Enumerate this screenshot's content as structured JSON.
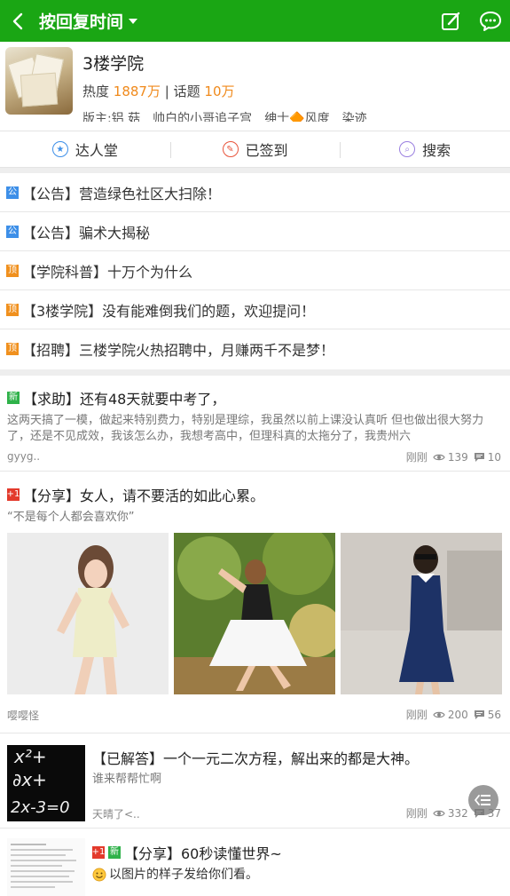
{
  "header": {
    "title": "按回复时间",
    "back_icon": "chevron-left-icon",
    "compose_icon": "compose-icon",
    "chat_icon": "chat-bubble-icon",
    "bar_color": "#1aa614"
  },
  "forum": {
    "name": "3楼学院",
    "heat_label": "热度",
    "heat_value": "1887万",
    "sep": "|",
    "topics_label": "话题",
    "topics_value": "10万",
    "moderators": "版主:铝 菇　帅白的小哥追子宫　绅士🔶风度　染迹"
  },
  "actions": [
    {
      "label": "达人堂",
      "icon": "star-badge-icon",
      "color": "#3d8fe8"
    },
    {
      "label": "已签到",
      "icon": "checkin-icon",
      "color": "#e8553c"
    },
    {
      "label": "搜索",
      "icon": "search-icon",
      "color": "#9a7fe0"
    }
  ],
  "notices": [
    {
      "tag": "公",
      "tag_color": "blue",
      "title": "【公告】营造绿色社区大扫除！"
    },
    {
      "tag": "公",
      "tag_color": "blue",
      "title": "【公告】骗术大揭秘"
    },
    {
      "tag": "顶",
      "tag_color": "orange",
      "title": "【学院科普】十万个为什么"
    },
    {
      "tag": "顶",
      "tag_color": "orange",
      "title": "【3楼学院】没有能难倒我们的题，欢迎提问！"
    },
    {
      "tag": "顶",
      "tag_color": "orange",
      "title": "【招聘】三楼学院火热招聘中，月赚两千不是梦！"
    }
  ],
  "posts": [
    {
      "tag": "新",
      "title": "【求助】还有48天就要中考了，",
      "excerpt": "这两天搞了一模，做起来特别费力，特别是理综，我虽然以前上课没认真听 但也做出很大努力了，还是不见成效，我该怎么办，我想考高中，但理科真的太拖分了，我贵州六",
      "author": "gyyg..",
      "time": "刚刚",
      "views": "139",
      "comments": "10"
    },
    {
      "tag": "+1",
      "title": "【分享】女人，请不要活的如此心累。",
      "subtitle": "“不是每个人都会喜欢你”",
      "author": "嘤嘤怪",
      "time": "刚刚",
      "views": "200",
      "comments": "56"
    },
    {
      "title": "【已解答】一个一元二次方程，解出来的都是大神。",
      "excerpt": "谁来帮帮忙啊",
      "author": "天晴了<..",
      "time": "刚刚",
      "views": "332",
      "comments": "37",
      "thumb_text": "x²+\n∂x+\n2x-3=0"
    },
    {
      "tags": [
        "+1",
        "新"
      ],
      "title": "【分享】60秒读懂世界~",
      "excerpt": "以图片的样子发给你们看。",
      "emoji_icon": "smile-emoji-icon"
    }
  ],
  "fab_icon": "menu-collapse-icon"
}
